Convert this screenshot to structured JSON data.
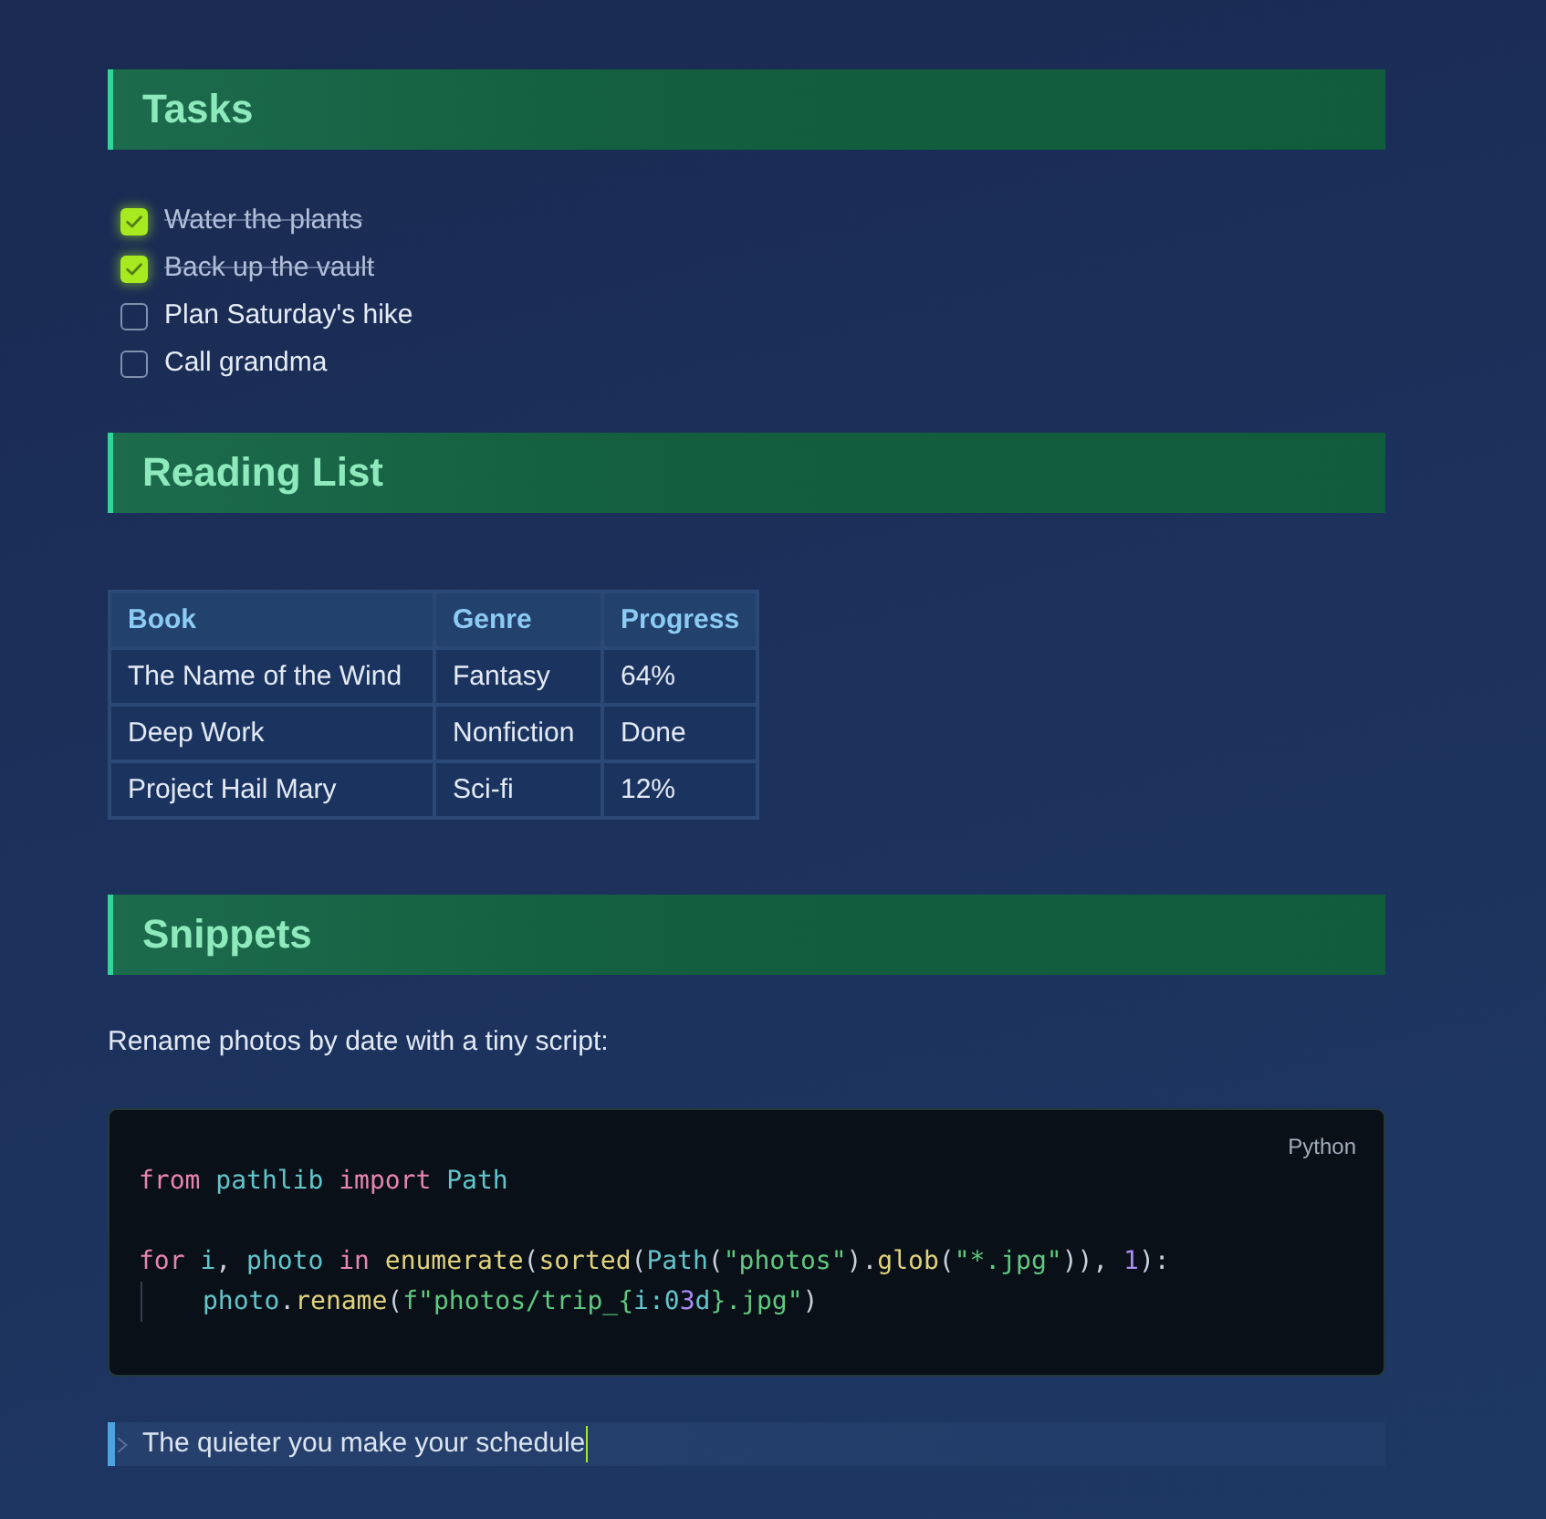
{
  "blocks": [
    {
      "kind": "heading",
      "text": "Tasks"
    },
    {
      "kind": "tasks",
      "items": [
        {
          "label": "Water the plants",
          "checked": true
        },
        {
          "label": "Back up the vault",
          "checked": true
        },
        {
          "label": "Plan Saturday's hike",
          "checked": false
        },
        {
          "label": "Call grandma",
          "checked": false
        }
      ]
    },
    {
      "kind": "heading",
      "text": "Reading List"
    },
    {
      "kind": "table",
      "columns": [
        "Book",
        "Genre",
        "Progress"
      ],
      "rows": [
        [
          "The Name of the Wind",
          "Fantasy",
          "64%"
        ],
        [
          "Deep Work",
          "Nonfiction",
          "Done"
        ],
        [
          "Project Hail Mary",
          "Sci-fi",
          "12%"
        ]
      ]
    },
    {
      "kind": "heading",
      "text": "Snippets"
    },
    {
      "kind": "paragraph",
      "text": "Rename photos by date with a tiny script:"
    },
    {
      "kind": "code",
      "language": "Python",
      "lines": [
        {
          "kind": "code",
          "tokens": [
            {
              "text": "from ",
              "kind": "keyword"
            },
            {
              "text": "pathlib ",
              "kind": "name"
            },
            {
              "text": "import ",
              "kind": "keyword"
            },
            {
              "text": "Path",
              "kind": "name"
            }
          ]
        },
        {
          "kind": "blank"
        },
        {
          "kind": "code",
          "tokens": [
            {
              "text": "for ",
              "kind": "keyword"
            },
            {
              "text": "i",
              "kind": "name"
            },
            {
              "text": ", ",
              "kind": "punct"
            },
            {
              "text": "photo ",
              "kind": "name"
            },
            {
              "text": "in ",
              "kind": "keyword"
            },
            {
              "text": "enumerate",
              "kind": "function"
            },
            {
              "text": "(",
              "kind": "punct"
            },
            {
              "text": "sorted",
              "kind": "function"
            },
            {
              "text": "(",
              "kind": "punct"
            },
            {
              "text": "Path",
              "kind": "name"
            },
            {
              "text": "(",
              "kind": "punct"
            },
            {
              "text": "\"photos\"",
              "kind": "string"
            },
            {
              "text": ").",
              "kind": "punct"
            },
            {
              "text": "glob",
              "kind": "function"
            },
            {
              "text": "(",
              "kind": "punct"
            },
            {
              "text": "\"*.jpg\"",
              "kind": "string"
            },
            {
              "text": ")), ",
              "kind": "punct"
            },
            {
              "text": "1",
              "kind": "number"
            },
            {
              "text": "):",
              "kind": "punct"
            }
          ],
          "children": [
            {
              "kind": "code",
              "tokens": [
                {
                  "text": "photo",
                  "kind": "name"
                },
                {
                  "text": ".",
                  "kind": "punct"
                },
                {
                  "text": "rename",
                  "kind": "function"
                },
                {
                  "text": "(",
                  "kind": "punct"
                },
                {
                  "text": "f\"photos/trip_{",
                  "kind": "string"
                },
                {
                  "text": "i:0",
                  "kind": "name"
                },
                {
                  "text": "3",
                  "kind": "number"
                },
                {
                  "text": "d",
                  "kind": "name"
                },
                {
                  "text": "}.jpg\"",
                  "kind": "string"
                },
                {
                  "text": ")",
                  "kind": "punct"
                }
              ]
            }
          ]
        }
      ]
    },
    {
      "kind": "quote",
      "text": "The quieter you make your schedule",
      "focused": true
    }
  ]
}
